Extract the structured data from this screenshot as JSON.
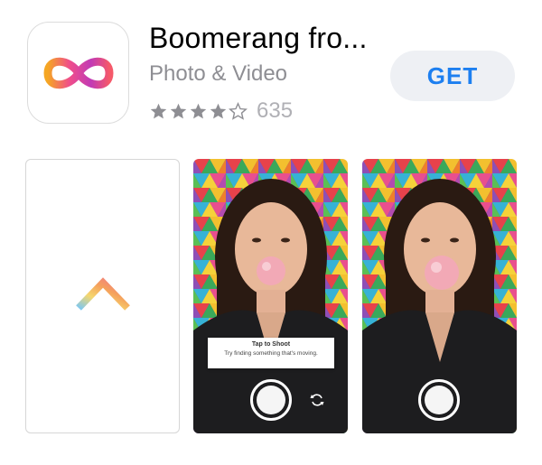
{
  "app": {
    "title": "Boomerang fro...",
    "category": "Photo & Video",
    "rating_stars": 4,
    "rating_max": 5,
    "rating_count": "635",
    "get_label": "GET",
    "icon": "infinity-logo-icon"
  },
  "colors": {
    "get_text": "#1d7ff0",
    "get_bg": "#eef0f4",
    "logo_gradient_start": "#f04e8a",
    "logo_gradient_end": "#f5a623"
  },
  "screenshots": [
    {
      "kind": "launch-screen",
      "icon": "rainbow-chevron-icon"
    },
    {
      "kind": "camera-preview",
      "tooltip": {
        "title": "Tap to Shoot",
        "subtitle": "Try finding something that's moving."
      },
      "icons": [
        "shutter-button-icon",
        "flip-camera-icon"
      ]
    },
    {
      "kind": "camera-preview",
      "icons": [
        "shutter-button-icon"
      ]
    }
  ]
}
